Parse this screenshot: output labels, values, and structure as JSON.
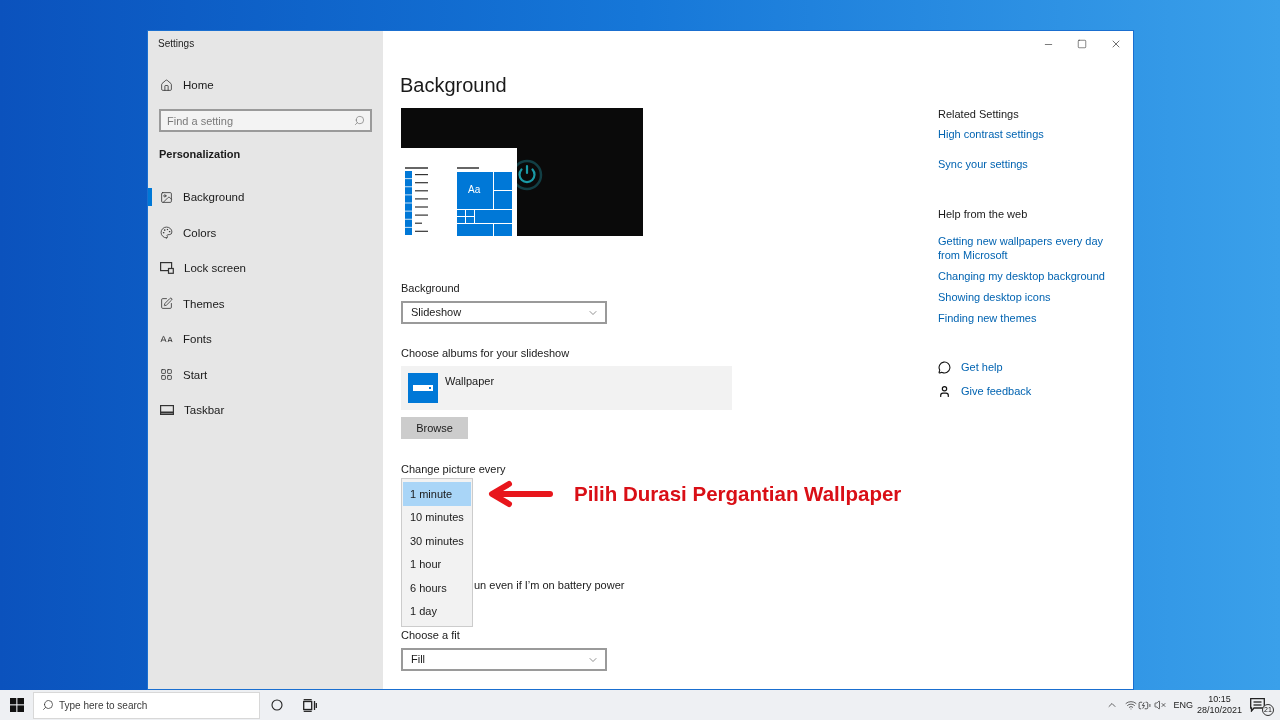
{
  "window": {
    "title": "Settings"
  },
  "sidebar": {
    "home": "Home",
    "search": {
      "placeholder": "Find a setting"
    },
    "section": "Personalization",
    "items": [
      {
        "label": "Background",
        "selected": true
      },
      {
        "label": "Colors",
        "selected": false
      },
      {
        "label": "Lock screen",
        "selected": false
      },
      {
        "label": "Themes",
        "selected": false
      },
      {
        "label": "Fonts",
        "selected": false
      },
      {
        "label": "Start",
        "selected": false
      },
      {
        "label": "Taskbar",
        "selected": false
      }
    ]
  },
  "page": {
    "title": "Background",
    "preview": {
      "tile_label": "Aa"
    },
    "background": {
      "label": "Background",
      "value": "Slideshow"
    },
    "albums": {
      "label": "Choose albums for your slideshow",
      "items": [
        "Wallpaper"
      ],
      "browse": "Browse"
    },
    "change_picture": {
      "label": "Change picture every",
      "options": [
        {
          "label": "1 minute",
          "selected": true
        },
        {
          "label": "10 minutes",
          "selected": false
        },
        {
          "label": "30 minutes",
          "selected": false
        },
        {
          "label": "1 hour",
          "selected": false
        },
        {
          "label": "6 hours",
          "selected": false
        },
        {
          "label": "1 day",
          "selected": false
        }
      ]
    },
    "battery_text": "un even if I’m on battery power",
    "fit": {
      "label": "Choose a fit",
      "value": "Fill"
    }
  },
  "annotation": {
    "text": "Pilih Durasi Pergantian Wallpaper"
  },
  "related_settings": {
    "heading": "Related Settings",
    "links": [
      "High contrast settings",
      "Sync your settings"
    ]
  },
  "help_from_web": {
    "heading": "Help from the web",
    "links": [
      "Getting new wallpapers every day from Microsoft",
      "Changing my desktop background",
      "Showing desktop icons",
      "Finding new themes"
    ]
  },
  "support_links": [
    "Get help",
    "Give feedback"
  ],
  "taskbar": {
    "search": {
      "placeholder": "Type here to search"
    },
    "language": "ENG",
    "time": "10:15",
    "date": "28/10/2021",
    "notification_count": "21"
  }
}
